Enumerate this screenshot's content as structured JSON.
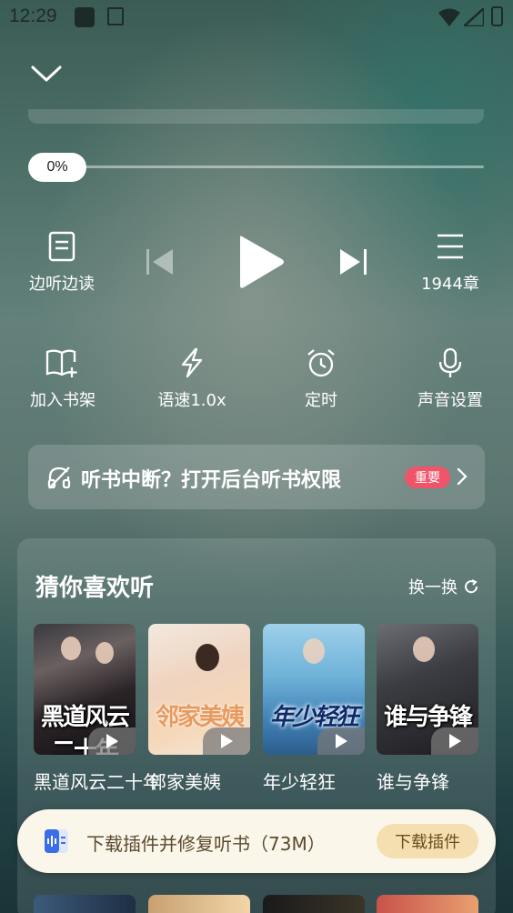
{
  "status_bar": {
    "time": "12:29"
  },
  "player": {
    "progress_text": "0%",
    "progress_fraction": 0.0,
    "read_along_label": "边听边读",
    "chapters_label": "1944章"
  },
  "actions": [
    {
      "label": "加入书架",
      "icon": "bookshelf-add-icon"
    },
    {
      "label": "语速1.0x",
      "icon": "lightning-icon"
    },
    {
      "label": "定时",
      "icon": "alarm-clock-icon"
    },
    {
      "label": "声音设置",
      "icon": "microphone-icon"
    }
  ],
  "banner": {
    "text": "听书中断？打开后台听书权限",
    "badge": "重要"
  },
  "recommend": {
    "title": "猜你喜欢听",
    "refresh_label": "换一换",
    "books": [
      {
        "name": "黑道风云二十年",
        "cover_title": "黑道风云二十年"
      },
      {
        "name": "邻家美姨",
        "cover_title": "邻家美姨"
      },
      {
        "name": "年少轻狂",
        "cover_title": "年少轻狂"
      },
      {
        "name": "谁与争锋",
        "cover_title": "谁与争锋"
      }
    ]
  },
  "download_bar": {
    "text": "下载插件并修复听书（73M）",
    "button": "下载插件"
  }
}
